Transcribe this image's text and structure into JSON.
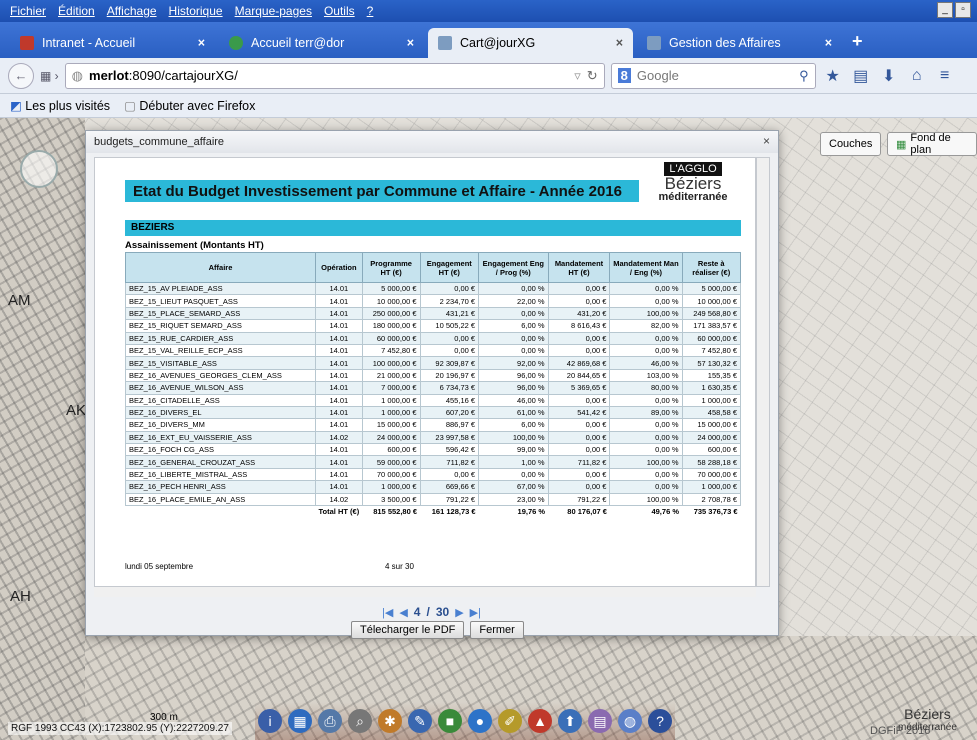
{
  "menu": [
    "Fichier",
    "Édition",
    "Affichage",
    "Historique",
    "Marque-pages",
    "Outils",
    "?"
  ],
  "tabs": [
    {
      "label": "Intranet - Accueil",
      "icon_color": "#c0392b",
      "active": false
    },
    {
      "label": "Accueil terr@dor",
      "icon_color": "#3a9a4a",
      "active": false
    },
    {
      "label": "Cart@jourXG",
      "icon_color": "#7d9cc0",
      "active": true
    },
    {
      "label": "Gestion des Affaires",
      "icon_color": "#7d9cc0",
      "active": false
    }
  ],
  "nav": {
    "url_host": "merlot",
    "url_rest": ":8090/cartajourXG/",
    "search_placeholder": "Google"
  },
  "bookmarks": [
    "Les plus visités",
    "Débuter avec Firefox"
  ],
  "map": {
    "labels": [
      "AM",
      "AK",
      "AH"
    ],
    "buttons": {
      "couches": "Couches",
      "fond": "Fond de plan"
    },
    "coords": "RGF 1993 CC43 (X):1723802.95 (Y):2227209.27",
    "scale": "300 m",
    "dgfip": "DGFiP 2016",
    "logo": {
      "name": "Béziers",
      "sub": "méditerranée"
    }
  },
  "dialog": {
    "title": "budgets_commune_affaire",
    "close": "×",
    "pager": {
      "current": "4",
      "total": "30",
      "sep": "/"
    },
    "download": "Télecharger le PDF",
    "close_btn": "Fermer"
  },
  "report": {
    "title": "Etat du Budget Investissement par Commune et Affaire - Année 2016",
    "brand": {
      "agglo": "L'AGGLO",
      "name": "Béziers",
      "sub": "méditerranée"
    },
    "commune": "BEZIERS",
    "section": "Assainissement (Montants HT)",
    "headers": [
      "Affaire",
      "Opération",
      "Programme HT (€)",
      "Engagement HT (€)",
      "Engagement Eng / Prog (%)",
      "Mandatement HT (€)",
      "Mandatement Man / Eng (%)",
      "Reste à réaliser (€)"
    ],
    "rows": [
      [
        "BEZ_15_AV PLEIADE_ASS",
        "14.01",
        "5 000,00 €",
        "0,00 €",
        "0,00 %",
        "0,00 €",
        "0,00 %",
        "5 000,00 €"
      ],
      [
        "BEZ_15_LIEUT PASQUET_ASS",
        "14.01",
        "10 000,00 €",
        "2 234,70 €",
        "22,00 %",
        "0,00 €",
        "0,00 %",
        "10 000,00 €"
      ],
      [
        "BEZ_15_PLACE_SEMARD_ASS",
        "14.01",
        "250 000,00 €",
        "431,21 €",
        "0,00 %",
        "431,20 €",
        "100,00 %",
        "249 568,80 €"
      ],
      [
        "BEZ_15_RIQUET SEMARD_ASS",
        "14.01",
        "180 000,00 €",
        "10 505,22 €",
        "6,00 %",
        "8 616,43 €",
        "82,00 %",
        "171 383,57 €"
      ],
      [
        "BEZ_15_RUE_CARDIER_ASS",
        "14.01",
        "60 000,00 €",
        "0,00 €",
        "0,00 %",
        "0,00 €",
        "0,00 %",
        "60 000,00 €"
      ],
      [
        "BEZ_15_VAL_REILLE_ECP_ASS",
        "14.01",
        "7 452,80 €",
        "0,00 €",
        "0,00 %",
        "0,00 €",
        "0,00 %",
        "7 452,80 €"
      ],
      [
        "BEZ_15_VISITABLE_ASS",
        "14.01",
        "100 000,00 €",
        "92 309,87 €",
        "92,00 %",
        "42 869,68 €",
        "46,00 %",
        "57 130,32 €"
      ],
      [
        "BEZ_16_AVENUES_GEORGES_CLEM_ASS",
        "14.01",
        "21 000,00 €",
        "20 196,97 €",
        "96,00 %",
        "20 844,65 €",
        "103,00 %",
        "155,35 €"
      ],
      [
        "BEZ_16_AVENUE_WILSON_ASS",
        "14.01",
        "7 000,00 €",
        "6 734,73 €",
        "96,00 %",
        "5 369,65 €",
        "80,00 %",
        "1 630,35 €"
      ],
      [
        "BEZ_16_CITADELLE_ASS",
        "14.01",
        "1 000,00 €",
        "455,16 €",
        "46,00 %",
        "0,00 €",
        "0,00 %",
        "1 000,00 €"
      ],
      [
        "BEZ_16_DIVERS_EL",
        "14.01",
        "1 000,00 €",
        "607,20 €",
        "61,00 %",
        "541,42 €",
        "89,00 %",
        "458,58 €"
      ],
      [
        "BEZ_16_DIVERS_MM",
        "14.01",
        "15 000,00 €",
        "886,97 €",
        "6,00 %",
        "0,00 €",
        "0,00 %",
        "15 000,00 €"
      ],
      [
        "BEZ_16_EXT_EU_VAISSERIE_ASS",
        "14.02",
        "24 000,00 €",
        "23 997,58 €",
        "100,00 %",
        "0,00 €",
        "0,00 %",
        "24 000,00 €"
      ],
      [
        "BEZ_16_FOCH CG_ASS",
        "14.01",
        "600,00 €",
        "596,42 €",
        "99,00 %",
        "0,00 €",
        "0,00 %",
        "600,00 €"
      ],
      [
        "BEZ_16_GENERAL_CROUZAT_ASS",
        "14.01",
        "59 000,00 €",
        "711,82 €",
        "1,00 %",
        "711,82 €",
        "100,00 %",
        "58 288,18 €"
      ],
      [
        "BEZ_16_LIBERTE_MISTRAL_ASS",
        "14.01",
        "70 000,00 €",
        "0,00 €",
        "0,00 %",
        "0,00 €",
        "0,00 %",
        "70 000,00 €"
      ],
      [
        "BEZ_16_PECH HENRI_ASS",
        "14.01",
        "1 000,00 €",
        "669,66 €",
        "67,00 %",
        "0,00 €",
        "0,00 %",
        "1 000,00 €"
      ],
      [
        "BEZ_16_PLACE_EMILE_AN_ASS",
        "14.02",
        "3 500,00 €",
        "791,22 €",
        "23,00 %",
        "791,22 €",
        "100,00 %",
        "2 708,78 €"
      ]
    ],
    "total": [
      "Total HT (€)",
      "815 552,80 €",
      "161 128,73 €",
      "19,76 %",
      "80 176,07 €",
      "49,76 %",
      "735 376,73 €"
    ],
    "footer_date": "lundi 05 septembre",
    "footer_page": "4 sur 30"
  }
}
